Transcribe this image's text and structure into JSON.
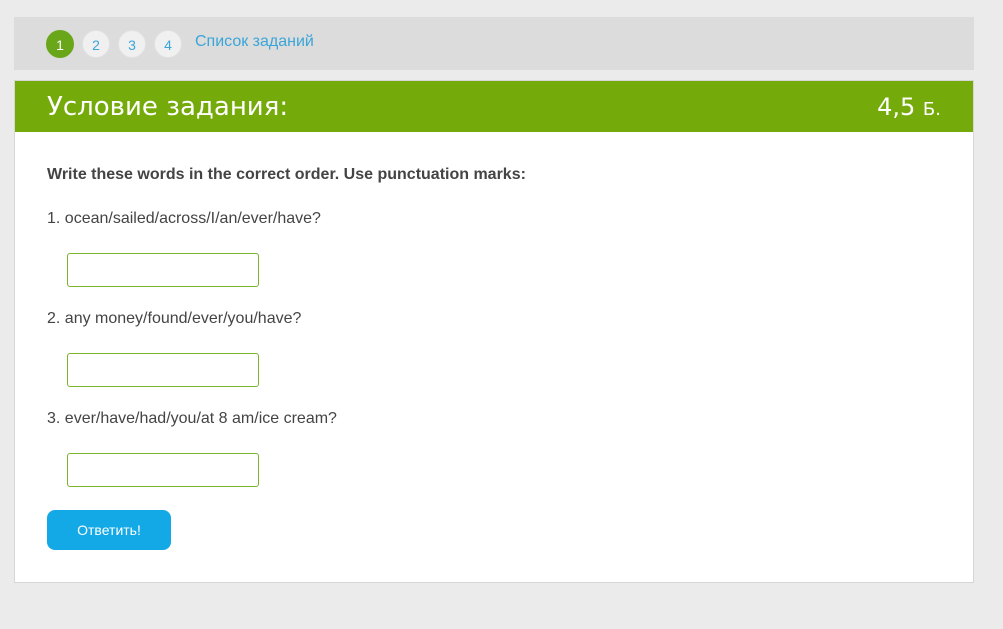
{
  "nav": {
    "steps": [
      "1",
      "2",
      "3",
      "4"
    ],
    "active_step": "1",
    "task_list_label": "Список заданий"
  },
  "task": {
    "title": "Условие задания:",
    "score_value": "4,5",
    "score_unit": "Б.",
    "instruction": "Write these words in the correct order. Use punctuation marks:",
    "questions": [
      {
        "text": "1. ocean/sailed/across/I/an/ever/have?",
        "answer": ""
      },
      {
        "text": "2. any money/found/ever/you/have?",
        "answer": ""
      },
      {
        "text": "3. ever/have/had/you/at 8 am/ice cream?",
        "answer": ""
      }
    ],
    "submit_label": "Ответить!"
  },
  "colors": {
    "header_green": "#74aa0a",
    "active_step_green": "#6aa61a",
    "link_blue": "#3aa5d8",
    "button_blue": "#13a9e6",
    "input_border_green": "#7ab32e"
  }
}
